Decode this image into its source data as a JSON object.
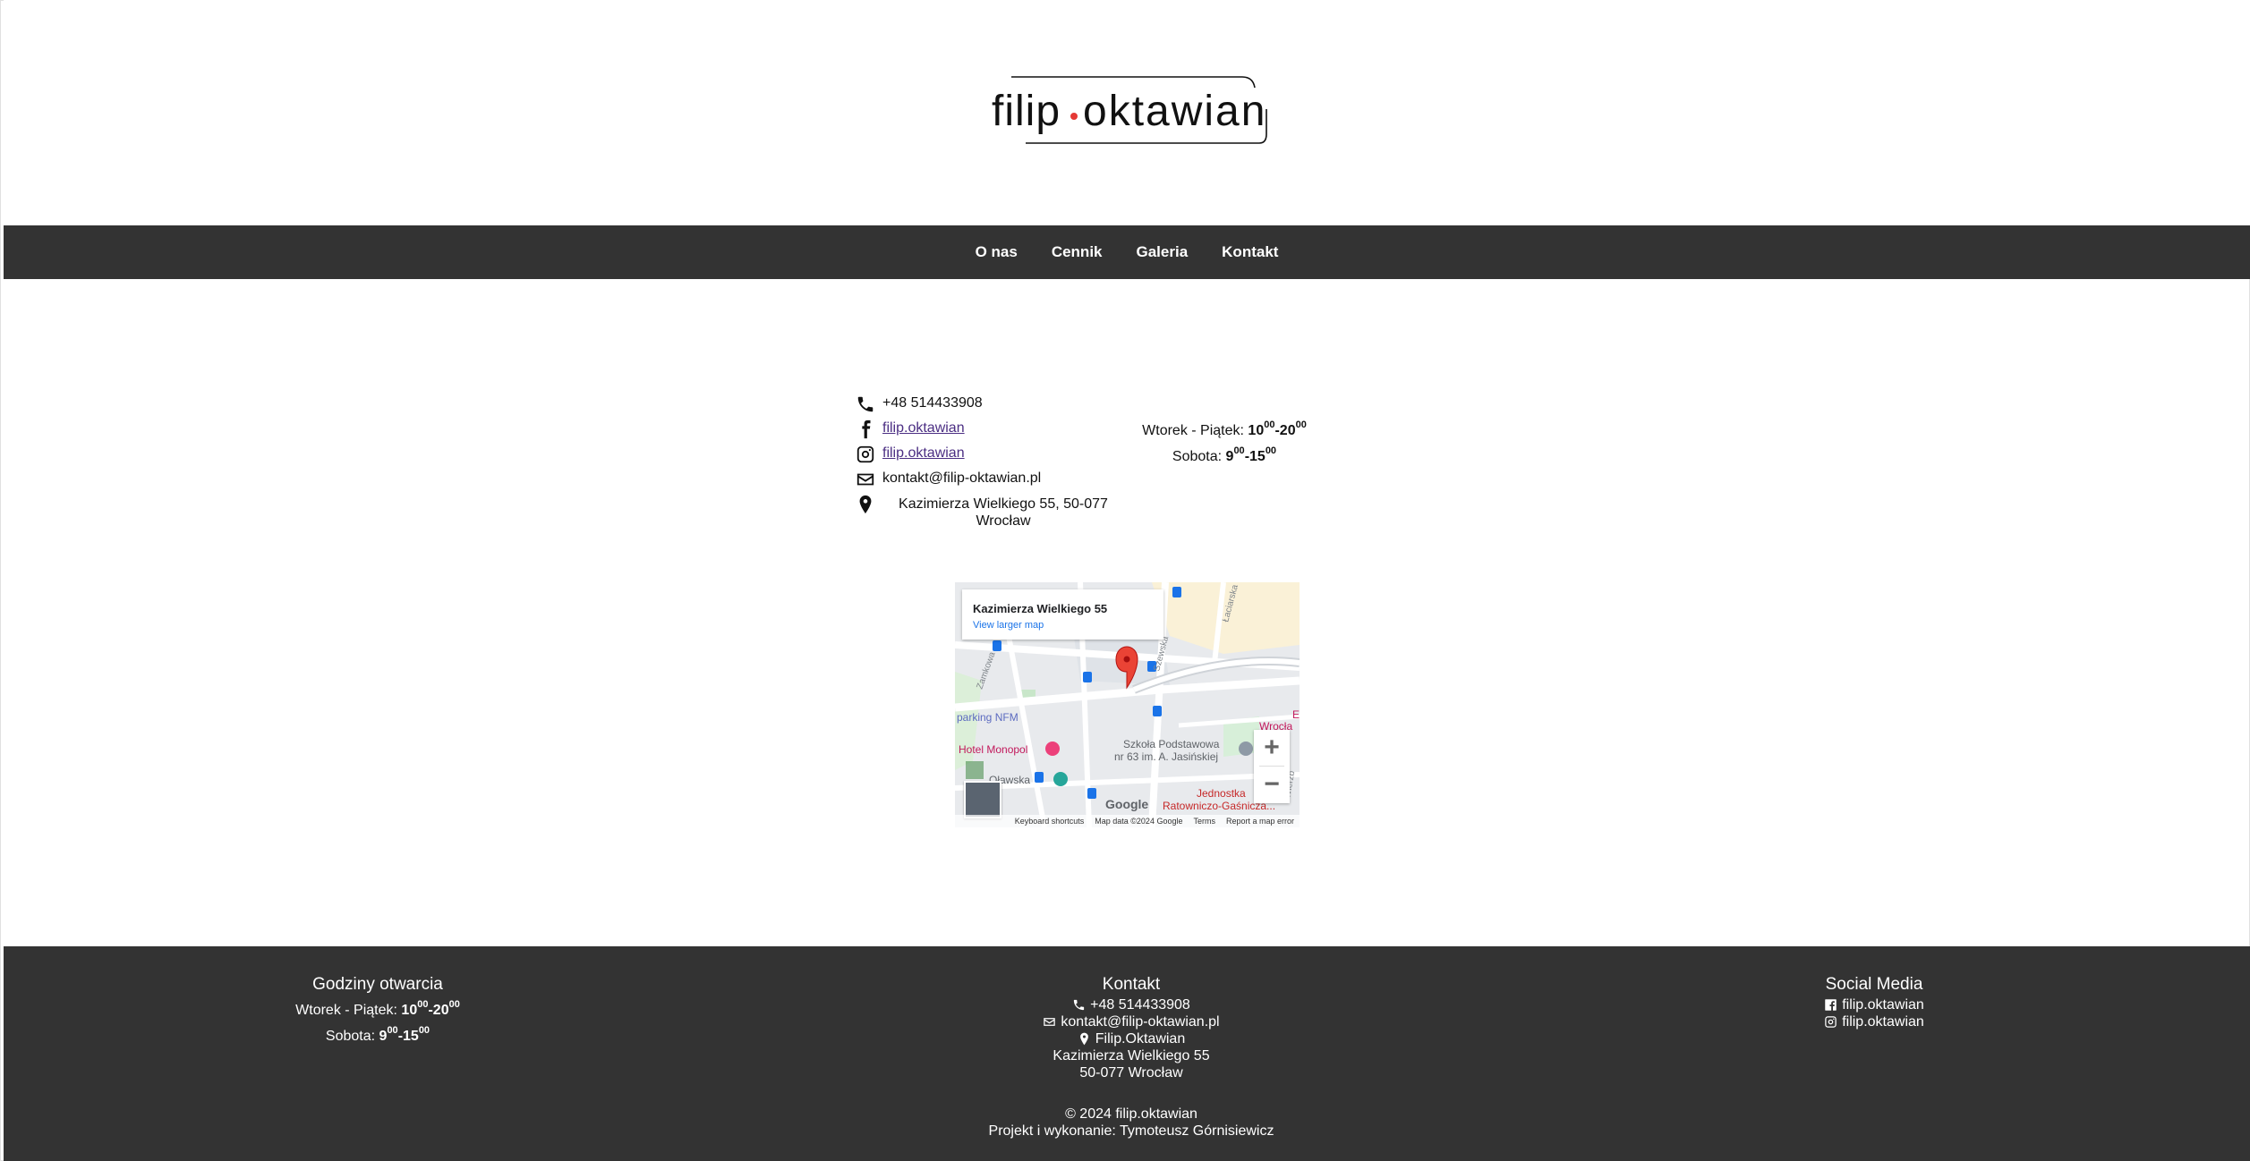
{
  "header": {
    "logo_text_left": "filip",
    "logo_text_right": "oktawian",
    "logo_dot_color": "#e53935"
  },
  "nav": {
    "items": [
      {
        "label": "O nas"
      },
      {
        "label": "Cennik"
      },
      {
        "label": "Galeria"
      },
      {
        "label": "Kontakt"
      }
    ]
  },
  "contact": {
    "phone": "+48 514433908",
    "facebook": "filip.oktawian",
    "instagram": "filip.oktawian",
    "email": "kontakt@filip-oktawian.pl",
    "address": "Kazimierza Wielkiego 55, 50-077 Wrocław"
  },
  "hours": {
    "weekday_label": "Wtorek - Piątek:",
    "weekday_open": "10",
    "weekday_open_min": "00",
    "weekday_close": "20",
    "weekday_close_min": "00",
    "saturday_label": "Sobota:",
    "saturday_open": "9",
    "saturday_open_min": "00",
    "saturday_close": "15",
    "saturday_close_min": "00"
  },
  "map": {
    "place_title": "Kazimierza Wielkiego 55",
    "larger_map_link": "View larger map",
    "zoom_in": "+",
    "zoom_out": "−",
    "keyboard_shortcuts": "Keyboard shortcuts",
    "map_data": "Map data ©2024 Google",
    "terms": "Terms",
    "report": "Report a map error",
    "google_mark": "Google",
    "labels": {
      "parking": "parking NFM",
      "hotel": "Hotel Monopol",
      "school_1": "Szkoła Podstawowa",
      "school_2": "nr 63 im. A. Jasińskiej",
      "fire_1": "Jednostka",
      "fire_2": "Ratowniczo-Gaśnicza...",
      "street_1": "Zamkowa",
      "street_2": "Szewska",
      "street_3": "Łaciarska",
      "street_4": "Oławska",
      "street_5": "Wierzb",
      "place_1": "Wrocła",
      "place_2": "E"
    },
    "pin_color": "#ea4335"
  },
  "footer": {
    "hours_heading": "Godziny otwarcia",
    "hours_weekday_label": "Wtorek - Piątek:",
    "hours_saturday_label": "Sobota:",
    "contact_heading": "Kontakt",
    "contact_phone": "+48 514433908",
    "contact_email": "kontakt@filip-oktawian.pl",
    "contact_name": "Filip.Oktawian",
    "contact_street": "Kazimierza Wielkiego 55",
    "contact_city": "50-077 Wrocław",
    "social_heading": "Social Media",
    "social_facebook": "filip.oktawian",
    "social_instagram": "filip.oktawian",
    "copyright": "© 2024 filip.oktawian",
    "credits": "Projekt i wykonanie: Tymoteusz Górnisiewicz"
  }
}
